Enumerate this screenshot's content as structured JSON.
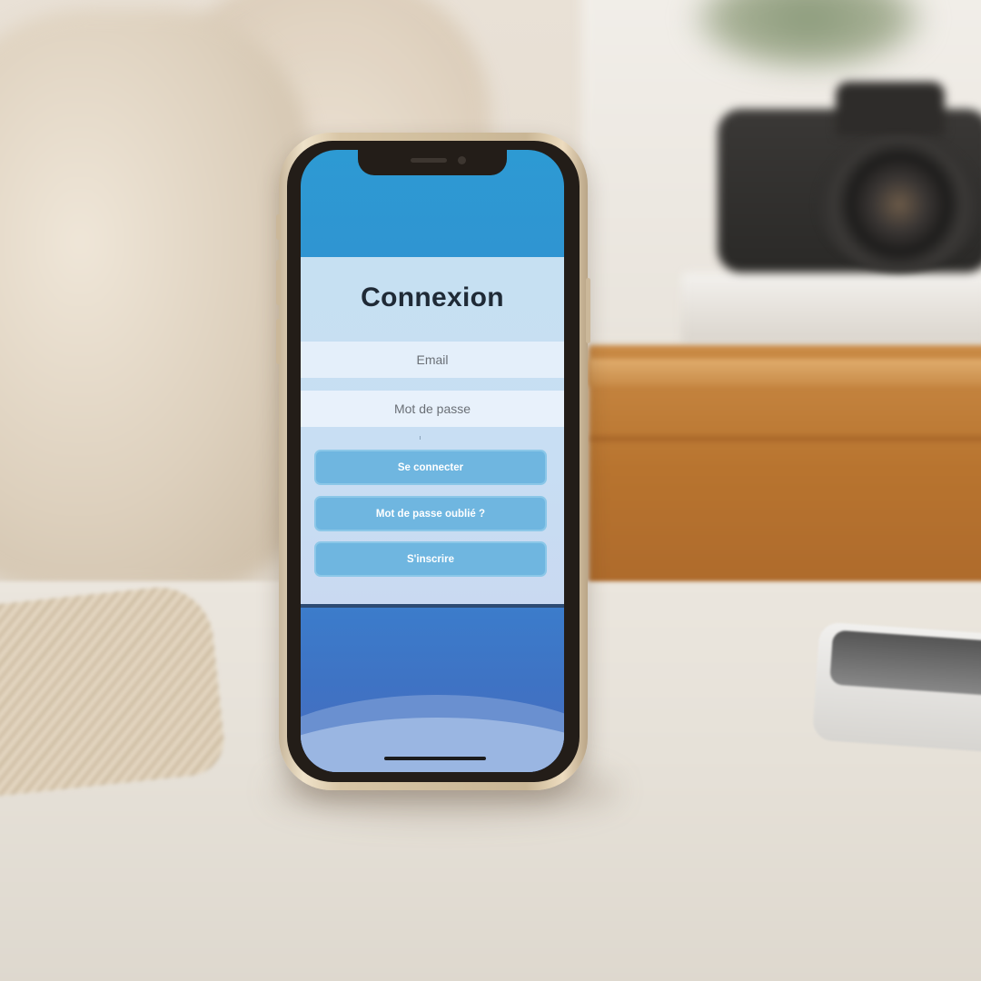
{
  "login": {
    "title": "Connexion",
    "email_placeholder": "Email",
    "password_placeholder": "Mot de passe",
    "login_button": "Se connecter",
    "forgot_button": "Mot de passe oublié ?",
    "signup_button": "S'inscrire"
  },
  "colors": {
    "screen_top": "#2d9ad3",
    "card_bg": "#c6e0f2",
    "button_bg": "#6fb6e0",
    "button_border": "#8bc7e8",
    "title_color": "#1f2a36"
  }
}
